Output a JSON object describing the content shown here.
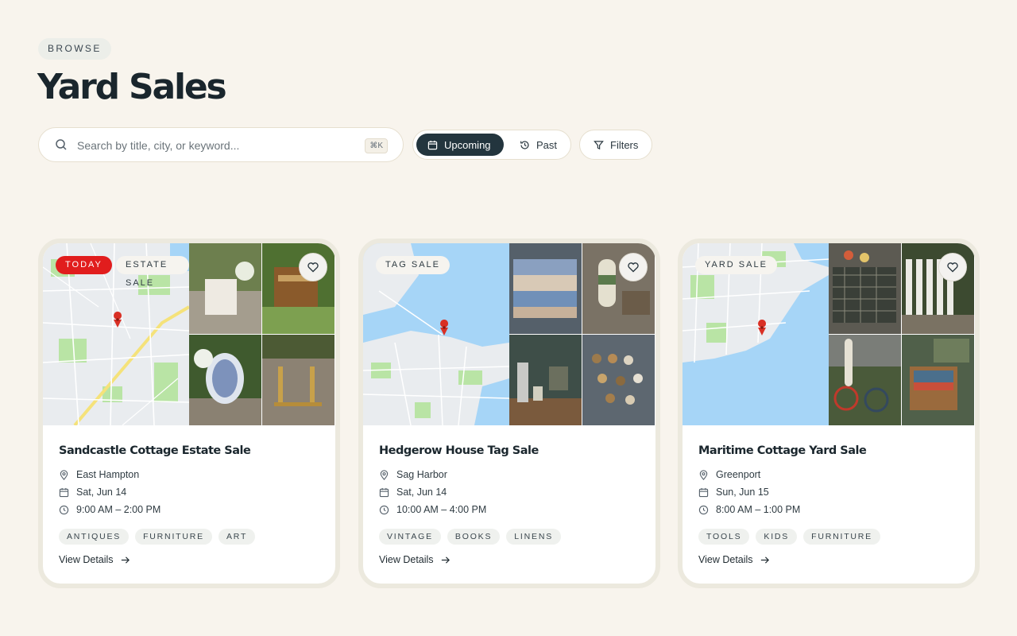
{
  "header": {
    "eyebrow": "BROWSE",
    "title": "Yard Sales"
  },
  "search": {
    "placeholder": "Search by title, city, or keyword...",
    "shortcut": "⌘K"
  },
  "toggle": {
    "upcoming": "Upcoming",
    "past": "Past"
  },
  "filters": {
    "label": "Filters"
  },
  "colors": {
    "background": "#f8f4ed",
    "accent_dark": "#23353e",
    "today_red": "#e11d1d",
    "water": "#a6d5f7",
    "park": "#b9e4a5"
  },
  "icons": {
    "search": "search-icon",
    "calendar": "calendar-icon",
    "history": "history-icon",
    "filter": "filter-icon",
    "heart": "heart-icon",
    "pin": "map-pin-icon",
    "clock": "clock-icon",
    "arrow": "arrow-right-icon"
  },
  "cards": [
    {
      "badges": [
        "TODAY",
        "ESTATE SALE"
      ],
      "title": "Sandcastle Cottage Estate Sale",
      "location": "East Hampton",
      "date": "Sat, Jun 14",
      "time": "9:00 AM – 2:00 PM",
      "tags": [
        "ANTIQUES",
        "FURNITURE",
        "ART"
      ],
      "cta": "View Details"
    },
    {
      "badges": [
        "TAG SALE"
      ],
      "title": "Hedgerow House Tag Sale",
      "location": "Sag Harbor",
      "date": "Sat, Jun 14",
      "time": "10:00 AM – 4:00 PM",
      "tags": [
        "VINTAGE",
        "BOOKS",
        "LINENS"
      ],
      "cta": "View Details"
    },
    {
      "badges": [
        "YARD SALE"
      ],
      "title": "Maritime Cottage Yard Sale",
      "location": "Greenport",
      "date": "Sun, Jun 15",
      "time": "8:00 AM – 1:00 PM",
      "tags": [
        "TOOLS",
        "KIDS",
        "FURNITURE"
      ],
      "cta": "View Details"
    }
  ]
}
